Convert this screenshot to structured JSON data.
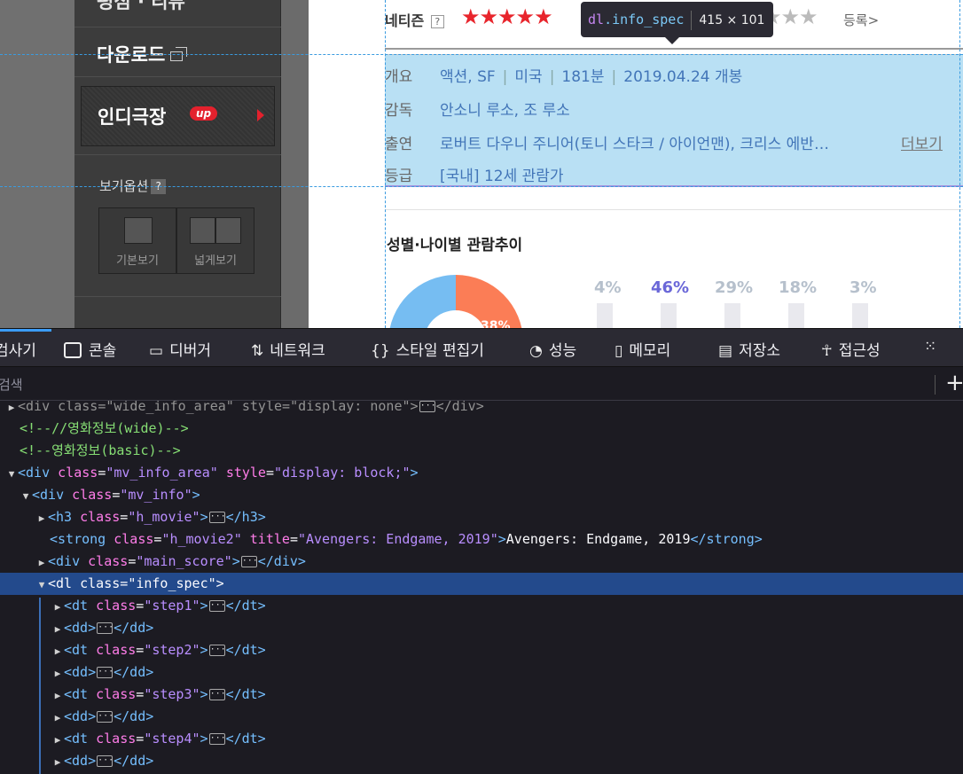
{
  "sidebar": {
    "top_item": "평점 · 리뷰",
    "download": "다운로드",
    "indie": "인디극장",
    "indie_badge": "up",
    "view_options_label": "보기옵션",
    "help": "?",
    "view_basic": "기본보기",
    "view_wide": "넓게보기"
  },
  "movie": {
    "netizen_label": "네티즌",
    "help": "?",
    "stars_filled": "★★★★★",
    "stars_empty": "★★★",
    "register": "등록>",
    "info": {
      "overview_label": "개요",
      "genre": "액션, SF",
      "country": "미국",
      "runtime": "181분",
      "release": "2019.04.24 개봉",
      "director_label": "감독",
      "director": "안소니 루소, 조 루소",
      "cast_label": "출연",
      "cast": "로버트 다우니 주니어(토니 스타크 / 아이언맨), 크리스 에반…",
      "more": "더보기",
      "rating_label": "등급",
      "rating": "[국내] 12세 관람가"
    },
    "chart_title": "성별·나이별 관람추이",
    "chart": {
      "percents": [
        "4%",
        "46%",
        "29%",
        "18%",
        "3%"
      ],
      "donut_label": "38%"
    }
  },
  "tooltip": {
    "tag": "dl",
    "cls": ".info_spec",
    "dims": "415 × 101"
  },
  "devtools": {
    "tabs": [
      "검사기",
      "콘솔",
      "디버거",
      "네트워크",
      "스타일 편집기",
      "성능",
      "메모리",
      "저장소",
      "접근성"
    ],
    "search_placeholder": "검색",
    "plus": "+",
    "ellipsis": "···",
    "tree": {
      "l1_tag": "div",
      "l1_attr1": "class",
      "l1_val1": "\"wide_info_area\"",
      "l1_attr2": "style",
      "l1_val2": "\"display: none\"",
      "l2_comment": "<!--//영화정보(wide)-->",
      "l3_comment": "<!--영화정보(basic)-->",
      "l4_tag": "div",
      "l4_attr1": "class",
      "l4_val1": "\"mv_info_area\"",
      "l4_attr2": "style",
      "l4_val2": "\"display: block;\"",
      "l5_tag": "div",
      "l5_attr": "class",
      "l5_val": "\"mv_info\"",
      "l6_tag": "h3",
      "l6_attr": "class",
      "l6_val": "\"h_movie\"",
      "l7_tag": "strong",
      "l7_attr1": "class",
      "l7_val1": "\"h_movie2\"",
      "l7_attr2": "title",
      "l7_val2": "\"Avengers: Endgame, 2019\"",
      "l7_text": "Avengers: Endgame, 2019",
      "l8_tag": "div",
      "l8_attr": "class",
      "l8_val": "\"main_score\"",
      "l9_tag": "dl",
      "l9_attr": "class",
      "l9_val": "\"info_spec\"",
      "dt_tag": "dt",
      "dd_tag": "dd",
      "dt_attr": "class",
      "step1": "\"step1\"",
      "step2": "\"step2\"",
      "step3": "\"step3\"",
      "step4": "\"step4\""
    }
  }
}
